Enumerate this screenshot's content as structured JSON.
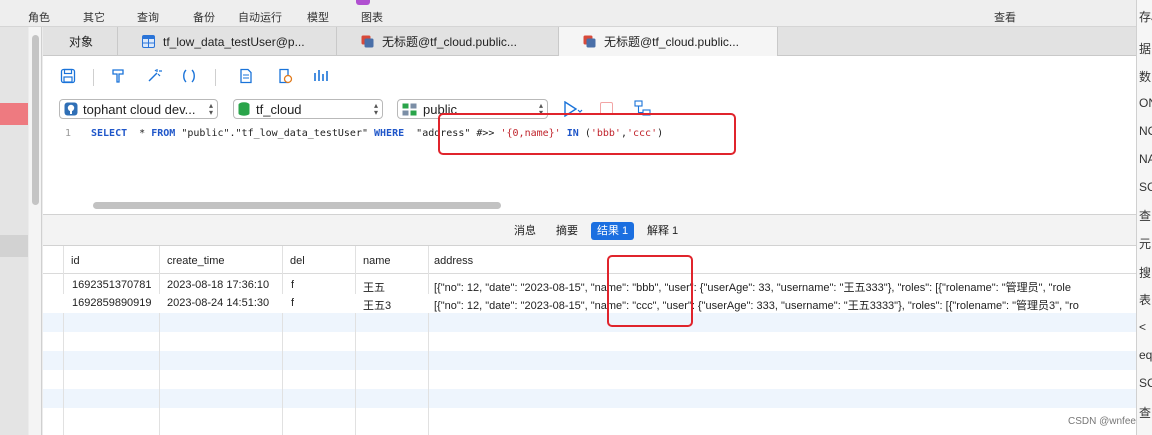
{
  "toolbar": {
    "items": [
      "角色",
      "其它",
      "查询",
      "备份",
      "自动运行",
      "模型",
      "图表",
      "查看"
    ]
  },
  "tabs": [
    {
      "label": "对象"
    },
    {
      "label": "tf_low_data_testUser@p..."
    },
    {
      "label": "无标题@tf_cloud.public..."
    },
    {
      "label": "无标题@tf_cloud.public..."
    }
  ],
  "editor": {
    "connection": "tophant cloud dev...",
    "database": "tf_cloud",
    "schema": "public",
    "line_number": "1",
    "sql": {
      "select": "SELECT",
      "star": "* ",
      "from": "FROM",
      "table": "\"public\".\"tf_low_data_testUser\"",
      "where": "WHERE",
      "col": "\"address\"",
      "op": "#>>",
      "path": "'{0,name}'",
      "in": "IN",
      "open": "(",
      "v1": "'bbb'",
      "comma": ",",
      "v2": "'ccc'",
      "close": ")"
    }
  },
  "result_tabs": [
    "消息",
    "摘要",
    "结果 1",
    "解释 1"
  ],
  "grid": {
    "columns": [
      "id",
      "create_time",
      "del",
      "name",
      "address"
    ],
    "rows": [
      [
        "1692351370781",
        "2023-08-18 17:36:10",
        "f",
        "王五",
        "[{\"no\": 12, \"date\": \"2023-08-15\", \"name\": \"bbb\", \"user\": {\"userAge\": 33, \"username\": \"王五333\"}, \"roles\": [{\"rolename\": \"管理员\", \"role"
      ],
      [
        "1692859890919",
        "2023-08-24 14:51:30",
        "f",
        "王五3",
        "[{\"no\": 12, \"date\": \"2023-08-15\", \"name\": \"ccc\", \"user\": {\"userAge\": 333, \"username\": \"王五3333\"}, \"roles\": [{\"rolename\": \"管理员3\", \"ro"
      ]
    ]
  },
  "right_panel_chars": [
    "存J",
    "据",
    "数",
    "ON",
    "NO",
    "NA",
    "SC",
    "查",
    "元",
    "搜",
    "表",
    "<",
    "eq",
    "SC",
    "查"
  ],
  "watermark": "CSDN @wnfee",
  "colors": {
    "accent": "#1b6fe0",
    "highlight_box": "#e0242c"
  }
}
